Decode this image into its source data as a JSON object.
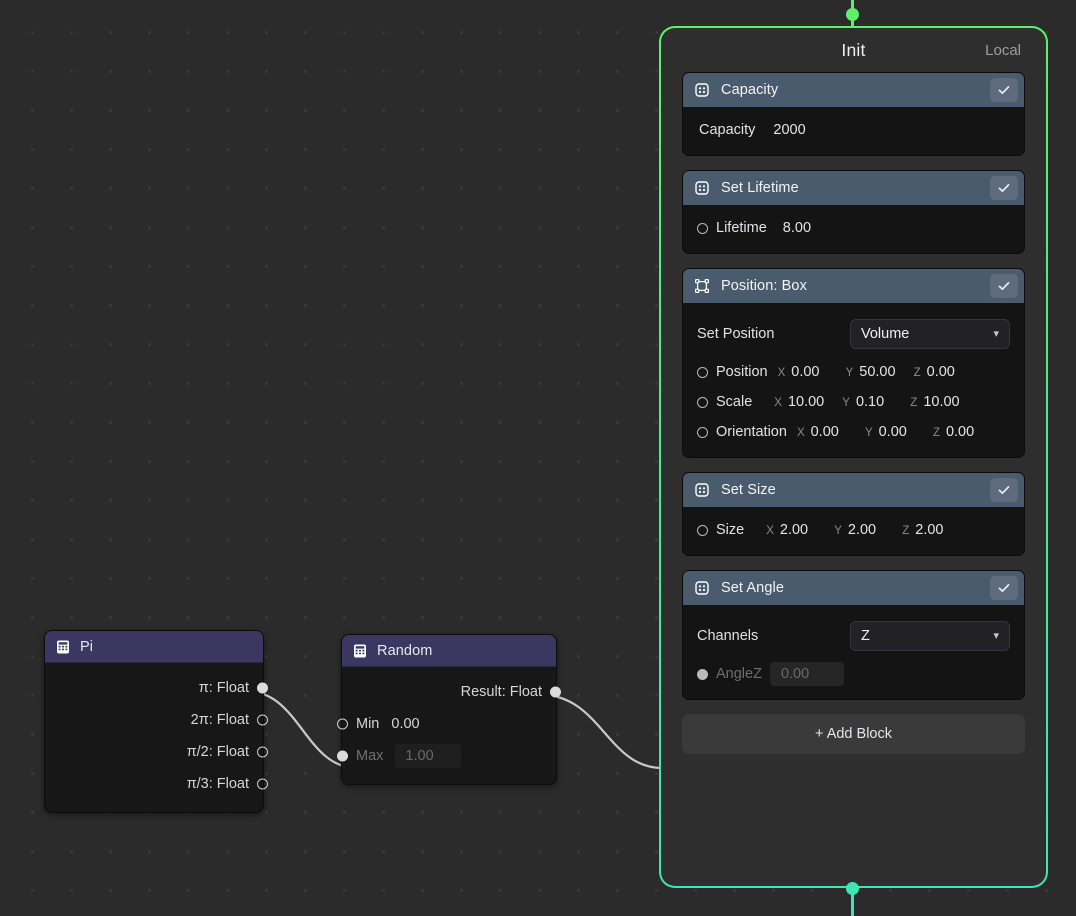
{
  "canvas": {
    "background_color": "#2b2b2b",
    "grid_dot_color": "#3a3a3a"
  },
  "accent": {
    "top": "#5ff06b",
    "bottom": "#3ee6b4",
    "block_header": "#4b5b6e",
    "node_header": "#3c3761"
  },
  "system_panel": {
    "title": "Init",
    "space": "Local",
    "add_block_label": "+ Add Block",
    "blocks": [
      {
        "icon": "block-dots-icon",
        "title": "Capacity",
        "enabled_icon": "check-icon",
        "rows": [
          {
            "kind": "scalar_plain",
            "label": "Capacity",
            "value": "2000"
          }
        ]
      },
      {
        "icon": "block-dots-icon",
        "title": "Set Lifetime",
        "enabled_icon": "check-icon",
        "rows": [
          {
            "kind": "scalar",
            "port": "hollow",
            "label": "Lifetime",
            "value": "8.00"
          }
        ]
      },
      {
        "icon": "transform-box-icon",
        "title": "Position: Box",
        "enabled_icon": "check-icon",
        "select": {
          "label": "Set Position",
          "value": "Volume",
          "chevron_icon": "chevron-down-icon"
        },
        "rows": [
          {
            "kind": "vector",
            "port": "hollow",
            "label": "Position",
            "x": "0.00",
            "y": "50.00",
            "z": "0.00"
          },
          {
            "kind": "vector",
            "port": "hollow",
            "label": "Scale",
            "x": "10.00",
            "y": "0.10",
            "z": "10.00"
          },
          {
            "kind": "vector",
            "port": "hollow",
            "label": "Orientation",
            "x": "0.00",
            "y": "0.00",
            "z": "0.00"
          }
        ]
      },
      {
        "icon": "block-dots-icon",
        "title": "Set Size",
        "enabled_icon": "check-icon",
        "rows": [
          {
            "kind": "vector",
            "port": "hollow",
            "label": "Size",
            "x": "2.00",
            "y": "2.00",
            "z": "2.00"
          }
        ]
      },
      {
        "icon": "block-dots-icon",
        "title": "Set Angle",
        "enabled_icon": "check-icon",
        "select": {
          "label": "Channels",
          "value": "Z",
          "chevron_icon": "chevron-down-icon"
        },
        "rows": [
          {
            "kind": "scalar_field",
            "port": "filled",
            "label": "AngleZ",
            "value": "0.00",
            "dimmed": true
          }
        ]
      }
    ],
    "axis_labels": {
      "x": "X",
      "y": "Y",
      "z": "Z"
    }
  },
  "nodes": [
    {
      "id": "pi",
      "title": "Pi",
      "icon": "calculator-icon",
      "outputs": [
        {
          "label": "π: Float",
          "port": "filled"
        },
        {
          "label": "2π: Float",
          "port": "hollow"
        },
        {
          "label": "π/2: Float",
          "port": "hollow"
        },
        {
          "label": "π/3: Float",
          "port": "hollow"
        }
      ],
      "inputs": []
    },
    {
      "id": "random",
      "title": "Random",
      "icon": "calculator-icon",
      "outputs": [
        {
          "label": "Result: Float",
          "port": "filled"
        }
      ],
      "inputs": [
        {
          "label": "Min",
          "value": "0.00",
          "port": "hollow",
          "dimmed": false,
          "boxed": false
        },
        {
          "label": "Max",
          "value": "1.00",
          "port": "filled",
          "dimmed": true,
          "boxed": true
        }
      ]
    }
  ],
  "wires": [
    {
      "from": "pi.pi-output",
      "to": "random.max-input"
    },
    {
      "from": "random.result-output",
      "to": "init.flow-input"
    }
  ]
}
